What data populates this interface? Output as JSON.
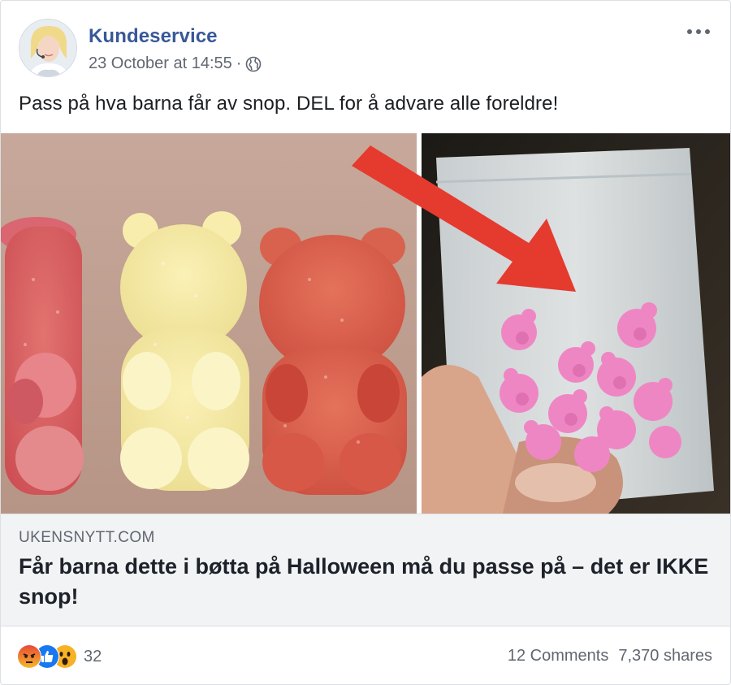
{
  "post": {
    "author": "Kundeservice",
    "timestamp": "23 October at 14:55",
    "separator": "·",
    "privacy_icon": "globe-icon",
    "more_icon": "more-options-icon",
    "text": "Pass på hva barna får av snop. DEL for å advare alle foreldre!"
  },
  "link_preview": {
    "domain": "UKENSNYTT.COM",
    "headline": "Får barna dette i bøtta på Halloween må du passe på – det er IKKE snop!"
  },
  "footer": {
    "reactions": [
      "angry",
      "like",
      "wow"
    ],
    "reaction_count": "32",
    "comments": "12 Comments",
    "shares": "7,370 shares"
  },
  "colors": {
    "link_blue": "#385898",
    "meta_gray": "#616770",
    "preview_bg": "#f2f3f5",
    "like_blue": "#1877f2",
    "angry_orange": "#e9710f",
    "wow_yellow": "#f7b125"
  }
}
